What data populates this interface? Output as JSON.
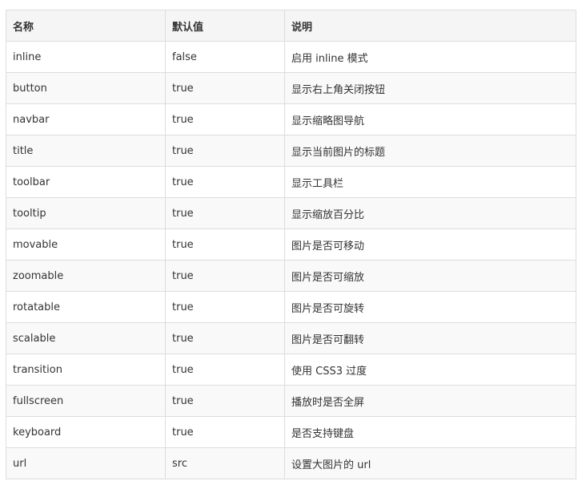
{
  "table": {
    "headers": [
      "名称",
      "默认值",
      "说明"
    ],
    "rows": [
      [
        "inline",
        "false",
        "启用 inline 模式"
      ],
      [
        "button",
        "true",
        "显示右上角关闭按钮"
      ],
      [
        "navbar",
        "true",
        "显示缩略图导航"
      ],
      [
        "title",
        "true",
        "显示当前图片的标题"
      ],
      [
        "toolbar",
        "true",
        "显示工具栏"
      ],
      [
        "tooltip",
        "true",
        "显示缩放百分比"
      ],
      [
        "movable",
        "true",
        "图片是否可移动"
      ],
      [
        "zoomable",
        "true",
        "图片是否可缩放"
      ],
      [
        "rotatable",
        "true",
        "图片是否可旋转"
      ],
      [
        "scalable",
        "true",
        "图片是否可翻转"
      ],
      [
        "transition",
        "true",
        "使用 CSS3 过度"
      ],
      [
        "fullscreen",
        "true",
        "播放时是否全屏"
      ],
      [
        "keyboard",
        "true",
        "是否支持键盘"
      ],
      [
        "url",
        "src",
        "设置大图片的 url"
      ]
    ]
  }
}
